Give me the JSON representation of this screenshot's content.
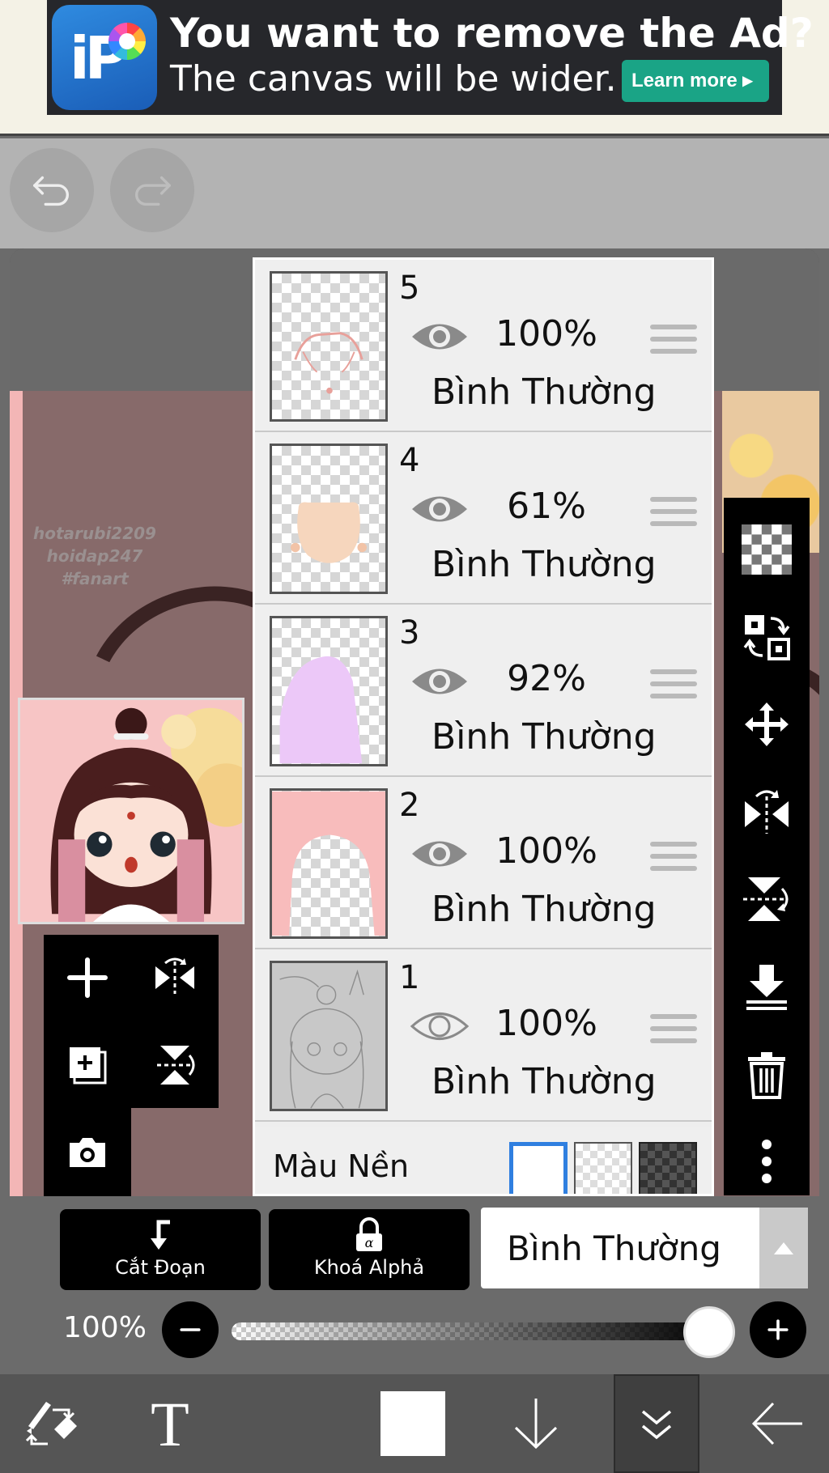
{
  "ad": {
    "title": "You want to remove the Ad?",
    "subtitle": "The canvas will be wider.",
    "cta": "Learn more ▸",
    "logo_text": "iP"
  },
  "canvas": {
    "watermark_line1": "hotarubi2209",
    "watermark_line2": "hoidap247",
    "watermark_line3": "#fanart"
  },
  "layers": [
    {
      "number": "5",
      "opacity": "100%",
      "blend": "Bình Thường",
      "visible": true
    },
    {
      "number": "4",
      "opacity": "61%",
      "blend": "Bình Thường",
      "visible": true
    },
    {
      "number": "3",
      "opacity": "92%",
      "blend": "Bình Thường",
      "visible": true
    },
    {
      "number": "2",
      "opacity": "100%",
      "blend": "Bình Thường",
      "visible": true
    },
    {
      "number": "1",
      "opacity": "100%",
      "blend": "Bình Thường",
      "visible": false
    }
  ],
  "background": {
    "label": "Màu Nền"
  },
  "controls": {
    "clipping_label": "Cắt Đoạn",
    "alpha_lock_label": "Khoá Alphả",
    "blend_mode": "Bình Thường",
    "opacity_label": "100%",
    "opacity_value": 1.0
  },
  "colors": {
    "accent_blue": "#2f7fe0",
    "panel_bg": "#eeeeee",
    "toolbar_black": "#000000"
  }
}
